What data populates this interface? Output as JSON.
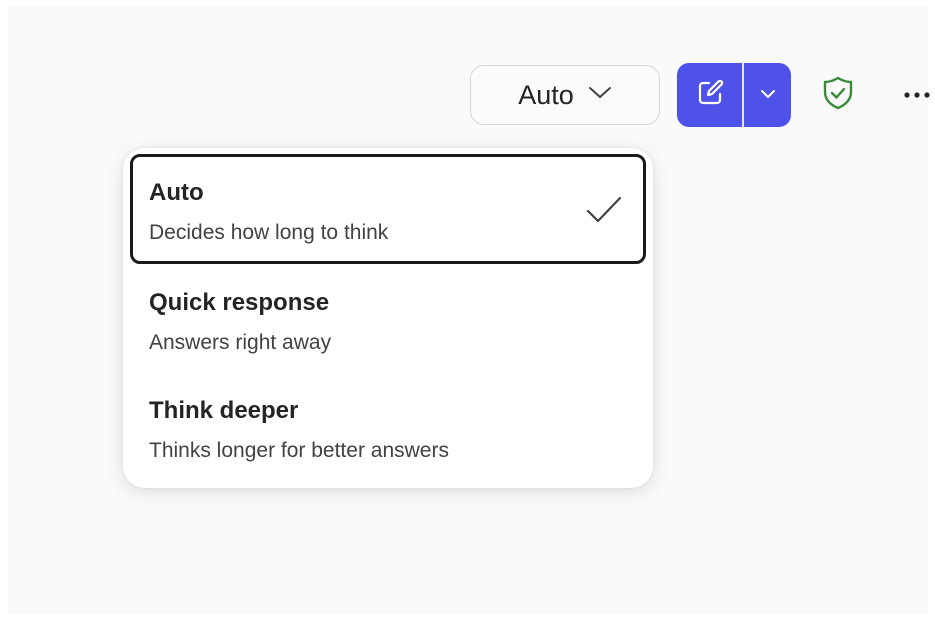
{
  "toolbar": {
    "mode_select": {
      "value": "Auto",
      "icon": "chevron-down-icon"
    },
    "compose_button": {
      "icon": "compose-icon",
      "color": "#4f52e8"
    },
    "compose_menu_button": {
      "icon": "chevron-down-icon"
    },
    "shield_button": {
      "icon": "shield-check-icon",
      "color": "#3a8a3a"
    },
    "more_button": {
      "icon": "more-horizontal-icon"
    }
  },
  "dropdown": {
    "options": [
      {
        "title": "Auto",
        "description": "Decides how long to think",
        "selected": true
      },
      {
        "title": "Quick response",
        "description": "Answers right away",
        "selected": false
      },
      {
        "title": "Think deeper",
        "description": "Thinks longer for better answers",
        "selected": false
      }
    ]
  }
}
